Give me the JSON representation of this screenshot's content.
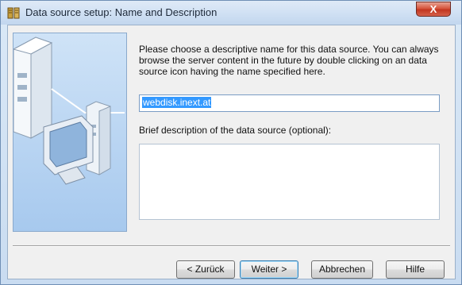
{
  "window": {
    "title": "Data source setup: Name and Description",
    "close_label": "X"
  },
  "main": {
    "description": "Please choose a descriptive name for this data source.  You can always browse the server content in the future by double clicking on an data source icon having the name specified here.",
    "name_value": "webdisk.inext.at",
    "description_label": "Brief description of the data source (optional):",
    "description_value": ""
  },
  "buttons": {
    "back": "< Zurück",
    "next": "Weiter >",
    "cancel": "Abbrechen",
    "help": "Hilfe"
  }
}
